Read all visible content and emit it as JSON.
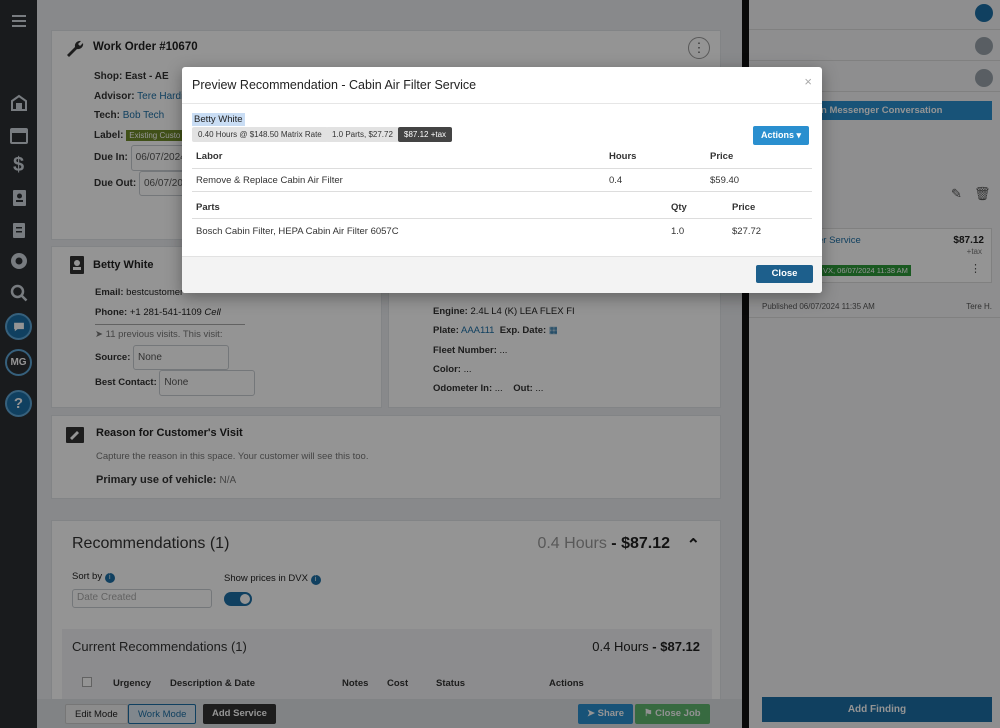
{
  "sidebar": {
    "items": [
      {
        "icon": "menu-icon"
      },
      {
        "icon": "shop-icon"
      },
      {
        "icon": "calendar-icon"
      },
      {
        "icon": "dollar-icon"
      },
      {
        "icon": "contacts-icon"
      },
      {
        "icon": "clipboard-icon"
      },
      {
        "icon": "tire-icon"
      },
      {
        "icon": "search-icon"
      },
      {
        "icon": "chat-icon"
      },
      {
        "icon": "help-icon"
      }
    ],
    "avatar_initials": "MG",
    "help_glyph": "?"
  },
  "work_order": {
    "title": "Work Order #10670",
    "shop_label": "Shop:",
    "shop_value": "East - AE",
    "advisor_label": "Advisor:",
    "advisor_value": "Tere Hardin",
    "tech_label": "Tech:",
    "tech_value": "Bob Tech",
    "label_label": "Label:",
    "label_value": "Existing Custo",
    "due_in_label": "Due In:",
    "due_in_value": "06/07/2024",
    "due_out_label": "Due Out:",
    "due_out_value": "06/07/202"
  },
  "customer": {
    "name": "Betty White",
    "email_label": "Email:",
    "email_value": "bestcustomer",
    "phone_label": "Phone:",
    "phone_value": "+1 281-541-1109",
    "phone_type": "Cell",
    "visits": "11 previous visits. This visit:",
    "source_label": "Source:",
    "source_value": "None",
    "best_contact_label": "Best Contact:",
    "best_contact_value": "None"
  },
  "vehicle": {
    "engine_label": "Engine:",
    "engine_value": "2.4L L4 (K) LEA FLEX FI",
    "plate_label": "Plate:",
    "plate_value": "AAA111",
    "exp_label": "Exp. Date:",
    "fleet_label": "Fleet Number:",
    "fleet_value": "...",
    "color_label": "Color:",
    "color_value": "...",
    "odometer_label": "Odometer In:",
    "odometer_value": "...",
    "out_label": "Out:",
    "out_value": "..."
  },
  "reason": {
    "title": "Reason for Customer's Visit",
    "placeholder": "Capture the reason in this space. Your customer will see this too.",
    "primary_use_label": "Primary use of vehicle:",
    "primary_use_value": "N/A"
  },
  "recommendations": {
    "title": "Recommendations (1)",
    "hours": "0.4 Hours",
    "separator": "-",
    "total": "$87.12",
    "sort_by_label": "Sort by",
    "sort_value": "Date Created",
    "show_prices_label": "Show prices in DVX",
    "current_title": "Current Recommendations (1)",
    "current_hours": "0.4 Hours",
    "current_total": "$87.12",
    "columns": [
      "Urgency",
      "Description & Date",
      "Notes",
      "Cost",
      "Status",
      "Actions"
    ]
  },
  "bottom_bar": {
    "edit_mode": "Edit Mode",
    "work_mode": "Work Mode",
    "add_service": "Add Service",
    "share": "Share",
    "close_job": "Close Job"
  },
  "right_panel": {
    "messenger_button": "n Messenger Conversation",
    "service_link": "er Service",
    "price": "$87.12",
    "tax": "+tax",
    "status_badge": "VX, 06/07/2024 11:38 AM",
    "published": "Published 06/07/2024 11:35 AM",
    "published_by": "Tere H.",
    "add_finding": "Add Finding"
  },
  "modal": {
    "title": "Preview Recommendation - Cabin Air Filter Service",
    "close_x": "×",
    "customer": "Betty White",
    "chips": [
      "0.40 Hours @ $148.50 Matrix Rate",
      "1.0 Parts, $27.72",
      "$87.12 +tax"
    ],
    "actions_label": "Actions",
    "labor": {
      "headers": [
        "Labor",
        "Hours",
        "Price"
      ],
      "rows": [
        [
          "Remove & Replace Cabin Air Filter",
          "0.4",
          "$59.40"
        ]
      ]
    },
    "parts": {
      "headers": [
        "Parts",
        "Qty",
        "Price"
      ],
      "rows": [
        [
          "Bosch Cabin Filter, HEPA Cabin Air Filter 6057C",
          "1.0",
          "$27.72"
        ]
      ]
    },
    "close_button": "Close"
  },
  "colors": {
    "sidebar": "#2b2f33",
    "accent": "#1d6fa5",
    "action_blue": "#2a8fcf",
    "modal_close_btn": "#1d5f8c",
    "green_badge": "#2d9a3a"
  }
}
